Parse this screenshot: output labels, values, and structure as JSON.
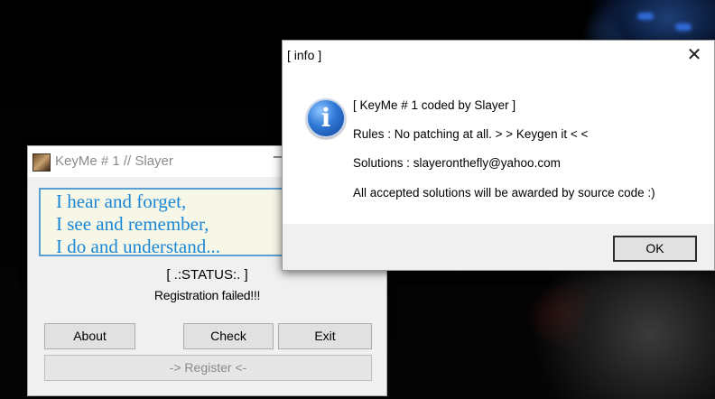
{
  "colors": {
    "motto_text": "#1b87d6",
    "motto_border": "#5a9fd4",
    "dialog_footer": "#f0f0f0",
    "window_bg": "#f0f0f0"
  },
  "keyme_window": {
    "title": "KeyMe # 1 // Slayer",
    "app_icon": "keyme-app-icon",
    "minimize_label": "—",
    "motto": [
      "I hear and forget,",
      "I see and remember,",
      "I do and understand..."
    ],
    "status_label": "[ .:STATUS:. ]",
    "status_text": "Registration failed!!!",
    "buttons": {
      "about": "About",
      "check": "Check",
      "exit": "Exit",
      "register": "-> Register <-"
    }
  },
  "info_dialog": {
    "title": "[ info ]",
    "close_label": "✕",
    "icon": "info-icon",
    "icon_glyph": "i",
    "lines": [
      "[ KeyMe # 1 coded by Slayer ]",
      "Rules : No patching at all. > > Keygen it < <",
      "Solutions : slayeronthefly@yahoo.com",
      "All accepted solutions will be awarded by source code :)"
    ],
    "ok_label": "OK"
  }
}
